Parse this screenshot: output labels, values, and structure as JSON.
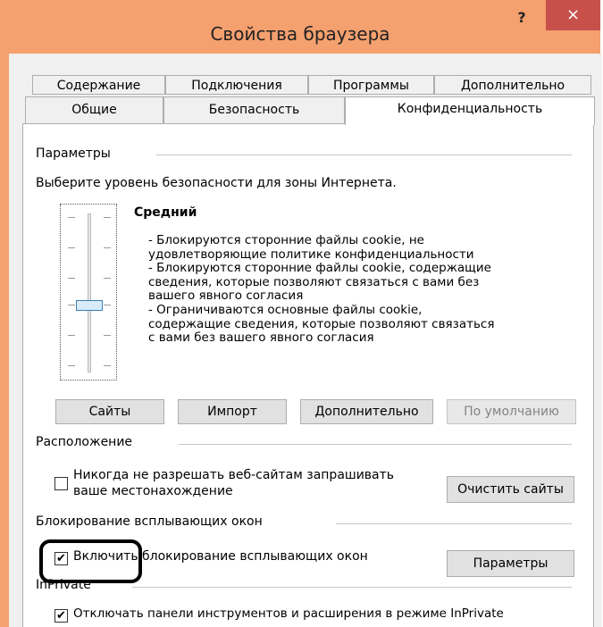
{
  "window": {
    "title": "Свойства браузера",
    "help": "?",
    "close": "×"
  },
  "tabs_top": [
    "Содержание",
    "Подключения",
    "Программы",
    "Дополнительно"
  ],
  "tabs_bottom": [
    "Общие",
    "Безопасность",
    "Конфиденциальность"
  ],
  "active_tab": "Конфиденциальность",
  "params": {
    "section_label": "Параметры",
    "instruction": "Выберите уровень безопасности для зоны Интернета.",
    "slider_level": 0.5,
    "level_name": "Средний",
    "description": "- Блокируются сторонние файлы cookie, не\nудовлетворяющие политике конфиденциальности\n- Блокируются сторонние файлы cookie, содержащие\nсведения, которые позволяют связаться с вами без\nвашего явного согласия\n- Ограничиваются основные файлы cookie,\nсодержащие сведения, которые позволяют связаться\nс вами без вашего явного согласия",
    "buttons": {
      "sites": "Сайты",
      "import": "Импорт",
      "advanced": "Дополнительно",
      "default": "По умолчанию"
    }
  },
  "location": {
    "section_label": "Расположение",
    "never_allow_line1": "Никогда не разрешать веб-сайтам запрашивать",
    "never_allow_line2": "ваше местонахождение",
    "never_allow_checked": false,
    "clear_sites": "Очистить сайты"
  },
  "popup": {
    "section_label": "Блокирование всплывающих окон",
    "enable_label": "Включить блокирование всплывающих окон",
    "enable_checked": true,
    "settings_button": "Параметры"
  },
  "inprivate": {
    "section_label": "InPrivate",
    "disable_toolbars_label": "Отключать панели инструментов и расширения в режиме InPrivate",
    "disable_toolbars_checked": true
  }
}
